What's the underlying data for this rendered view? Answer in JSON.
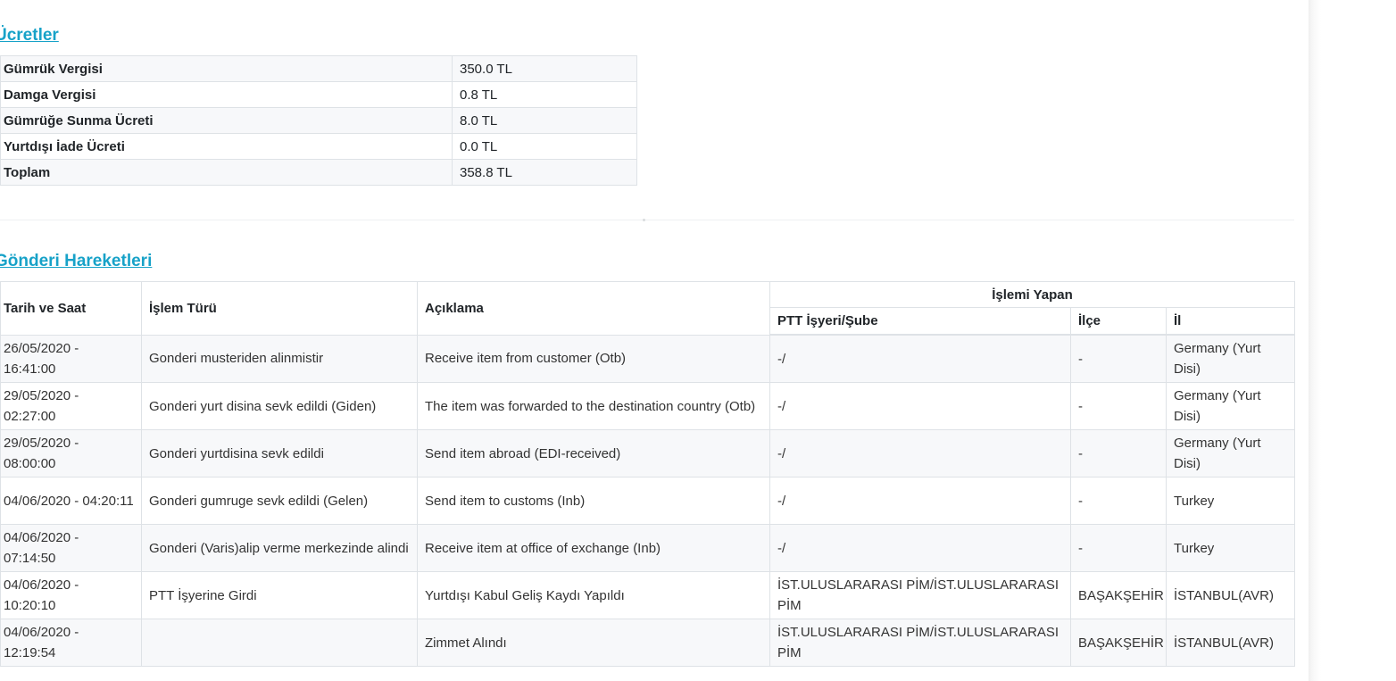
{
  "fees": {
    "title": "Ücretler",
    "rows": [
      {
        "label": "Gümrük Vergisi",
        "value": "350.0 TL"
      },
      {
        "label": "Damga Vergisi",
        "value": "0.8 TL"
      },
      {
        "label": "Gümrüğe Sunma Ücreti",
        "value": "8.0 TL"
      },
      {
        "label": "Yurtdışı İade Ücreti",
        "value": "0.0 TL"
      },
      {
        "label": "Toplam",
        "value": "358.8 TL"
      }
    ]
  },
  "moves": {
    "title": "Gönderi Hareketleri",
    "headers": {
      "date": "Tarih ve Saat",
      "type": "İşlem Türü",
      "desc": "Açıklama",
      "performer": "İşlemi Yapan",
      "office": "PTT İşyeri/Şube",
      "district": "İlçe",
      "city": "İl"
    },
    "rows": [
      {
        "date": "26/05/2020 - 16:41:00",
        "type": "Gonderi musteriden alinmistir",
        "desc": "Receive item from customer (Otb)",
        "office": "-/",
        "district": "-",
        "city": "Germany (Yurt Disi)"
      },
      {
        "date": "29/05/2020 - 02:27:00",
        "type": "Gonderi yurt disina sevk edildi (Giden)",
        "desc": "The item was forwarded to the destination country (Otb)",
        "office": "-/",
        "district": "-",
        "city": "Germany (Yurt Disi)"
      },
      {
        "date": "29/05/2020 - 08:00:00",
        "type": "Gonderi yurtdisina sevk edildi",
        "desc": "Send item abroad (EDI-received)",
        "office": "-/",
        "district": "-",
        "city": "Germany (Yurt Disi)"
      },
      {
        "date": "04/06/2020 - 04:20:11",
        "type": "Gonderi gumruge sevk edildi (Gelen)",
        "desc": "Send item to customs (Inb)",
        "office": "-/",
        "district": "-",
        "city": "Turkey"
      },
      {
        "date": "04/06/2020 - 07:14:50",
        "type": "Gonderi (Varis)alip verme merkezinde alindi",
        "desc": "Receive item at office of exchange (Inb)",
        "office": "-/",
        "district": "-",
        "city": "Turkey"
      },
      {
        "date": "04/06/2020 - 10:20:10",
        "type": "PTT İşyerine Girdi",
        "desc": "Yurtdışı Kabul Geliş Kaydı Yapıldı",
        "office": "İST.ULUSLARARASI PİM/İST.ULUSLARARASI PİM",
        "district": "BAŞAKŞEHİR",
        "city": "İSTANBUL(AVR)"
      },
      {
        "date": "04/06/2020 - 12:19:54",
        "type": "",
        "desc": "Zimmet Alındı",
        "office": "İST.ULUSLARARASI PİM/İST.ULUSLARARASI PİM",
        "district": "BAŞAKŞEHİR",
        "city": "İSTANBUL(AVR)"
      }
    ]
  }
}
